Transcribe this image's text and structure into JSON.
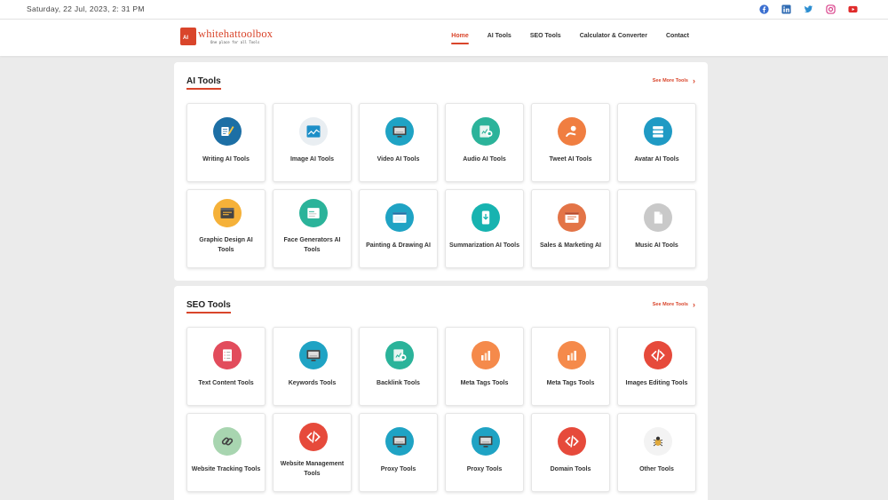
{
  "topbar": {
    "date": "Saturday, 22 Jul, 2023, 2: 31 PM",
    "social": [
      "facebook-icon",
      "linkedin-icon",
      "twitter-icon",
      "instagram-icon",
      "youtube-icon"
    ]
  },
  "brand": {
    "mark": "AI",
    "name": "whitehattoolbox",
    "tagline": "One place for all Tools",
    "color": "#d9452b"
  },
  "nav": {
    "items": [
      "Home",
      "AI Tools",
      "SEO Tools",
      "Calculator & Converter",
      "Contact"
    ],
    "active": "Home"
  },
  "ai_section": {
    "title": "AI Tools",
    "see_more": "See More Tools",
    "tools": [
      {
        "label": "Writing AI Tools",
        "icon": "writing-icon",
        "color": "#1d6fa5"
      },
      {
        "label": "Image AI Tools",
        "icon": "image-chart-icon",
        "color": "#e9eef2"
      },
      {
        "label": "Video AI Tools",
        "icon": "monitor-icon",
        "color": "#1fa3c4"
      },
      {
        "label": "Audio AI Tools",
        "icon": "audio-chart-icon",
        "color": "#2bb39a"
      },
      {
        "label": "Tweet AI Tools",
        "icon": "hand-coin-icon",
        "color": "#f07e41"
      },
      {
        "label": "Avatar AI Tools",
        "icon": "stack-icon",
        "color": "#1f9ac4"
      },
      {
        "label": "Graphic Design AI Tools",
        "icon": "design-window-icon",
        "color": "#f5b139"
      },
      {
        "label": "Face Generators AI Tools",
        "icon": "face-window-icon",
        "color": "#2bb39a"
      },
      {
        "label": "Painting & Drawing AI",
        "icon": "browser-window-icon",
        "color": "#1fa3c4"
      },
      {
        "label": "Summarization AI Tools",
        "icon": "mobile-download-icon",
        "color": "#17b3b0"
      },
      {
        "label": "Sales & Marketing AI",
        "icon": "sales-window-icon",
        "color": "#e37447"
      },
      {
        "label": "Music AI Tools",
        "icon": "document-icon",
        "color": "#c9c9c9"
      }
    ]
  },
  "seo_section": {
    "title": "SEO Tools",
    "see_more": "See More Tools",
    "tools": [
      {
        "label": "Text Content Tools",
        "icon": "checklist-icon",
        "color": "#e24c5c"
      },
      {
        "label": "Keywords Tools",
        "icon": "monitor-icon",
        "color": "#1fa3c4"
      },
      {
        "label": "Backlink Tools",
        "icon": "audio-chart-icon",
        "color": "#2bb39a"
      },
      {
        "label": "Meta Tags Tools",
        "icon": "bar-chart-icon",
        "color": "#f58a4b"
      },
      {
        "label": "Meta Tags Tools",
        "icon": "bar-chart-icon",
        "color": "#f58a4b"
      },
      {
        "label": "Images Editing Tools",
        "icon": "code-icon",
        "color": "#e64a3b"
      },
      {
        "label": "Website Tracking Tools",
        "icon": "link-icon",
        "color": "#a8d5b0"
      },
      {
        "label": "Website Management Tools",
        "icon": "code-icon",
        "color": "#e64a3b"
      },
      {
        "label": "Proxy Tools",
        "icon": "monitor-icon",
        "color": "#1fa3c4"
      },
      {
        "label": "Proxy Tools",
        "icon": "monitor-icon",
        "color": "#1fa3c4"
      },
      {
        "label": "Domain Tools",
        "icon": "code-icon",
        "color": "#e64a3b"
      },
      {
        "label": "Other Tools",
        "icon": "bug-icon",
        "color": "#f3f3f3"
      }
    ]
  }
}
